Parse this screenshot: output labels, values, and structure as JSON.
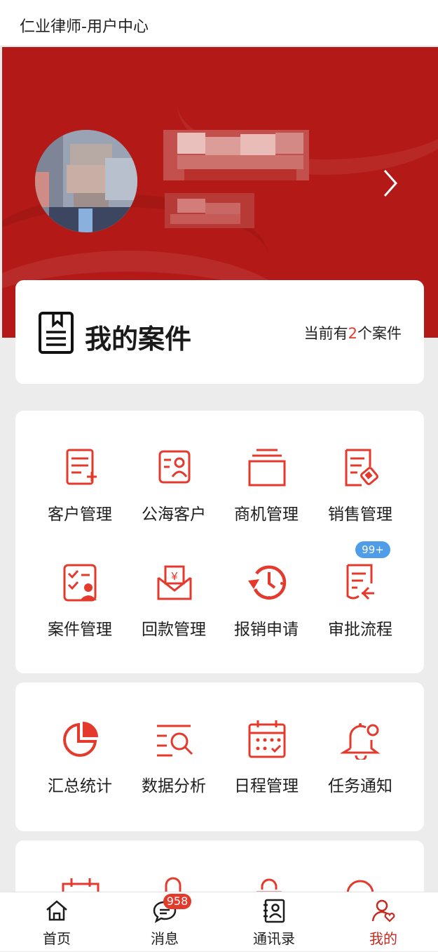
{
  "header": {
    "title": "仁业律师-用户中心"
  },
  "colors": {
    "brand_red": "#b31916",
    "icon_red": "#e43a2e",
    "badge_blue": "#4f9de8",
    "badge_red": "#e23b2b"
  },
  "cases": {
    "title": "我的案件",
    "count_prefix": "当前有",
    "count": "2",
    "count_suffix": "个案件"
  },
  "grid1": {
    "items": [
      {
        "label": "客户管理",
        "icon": "customer-list-icon"
      },
      {
        "label": "公海客户",
        "icon": "public-customer-icon"
      },
      {
        "label": "商机管理",
        "icon": "opportunity-box-icon"
      },
      {
        "label": "销售管理",
        "icon": "sales-document-icon"
      },
      {
        "label": "案件管理",
        "icon": "case-user-icon"
      },
      {
        "label": "回款管理",
        "icon": "payment-envelope-icon"
      },
      {
        "label": "报销申请",
        "icon": "clock-arrow-icon"
      },
      {
        "label": "审批流程",
        "icon": "approval-document-icon"
      }
    ],
    "approval_badge": "99+"
  },
  "grid2": {
    "items": [
      {
        "label": "汇总统计",
        "icon": "pie-chart-icon"
      },
      {
        "label": "数据分析",
        "icon": "data-search-icon"
      },
      {
        "label": "日程管理",
        "icon": "calendar-icon"
      },
      {
        "label": "任务通知",
        "icon": "bell-icon"
      }
    ]
  },
  "tabs": [
    {
      "label": "首页",
      "icon": "home-icon"
    },
    {
      "label": "消息",
      "icon": "chat-icon",
      "badge": "958"
    },
    {
      "label": "通讯录",
      "icon": "contacts-icon"
    },
    {
      "label": "我的",
      "icon": "profile-icon",
      "active": true
    }
  ]
}
